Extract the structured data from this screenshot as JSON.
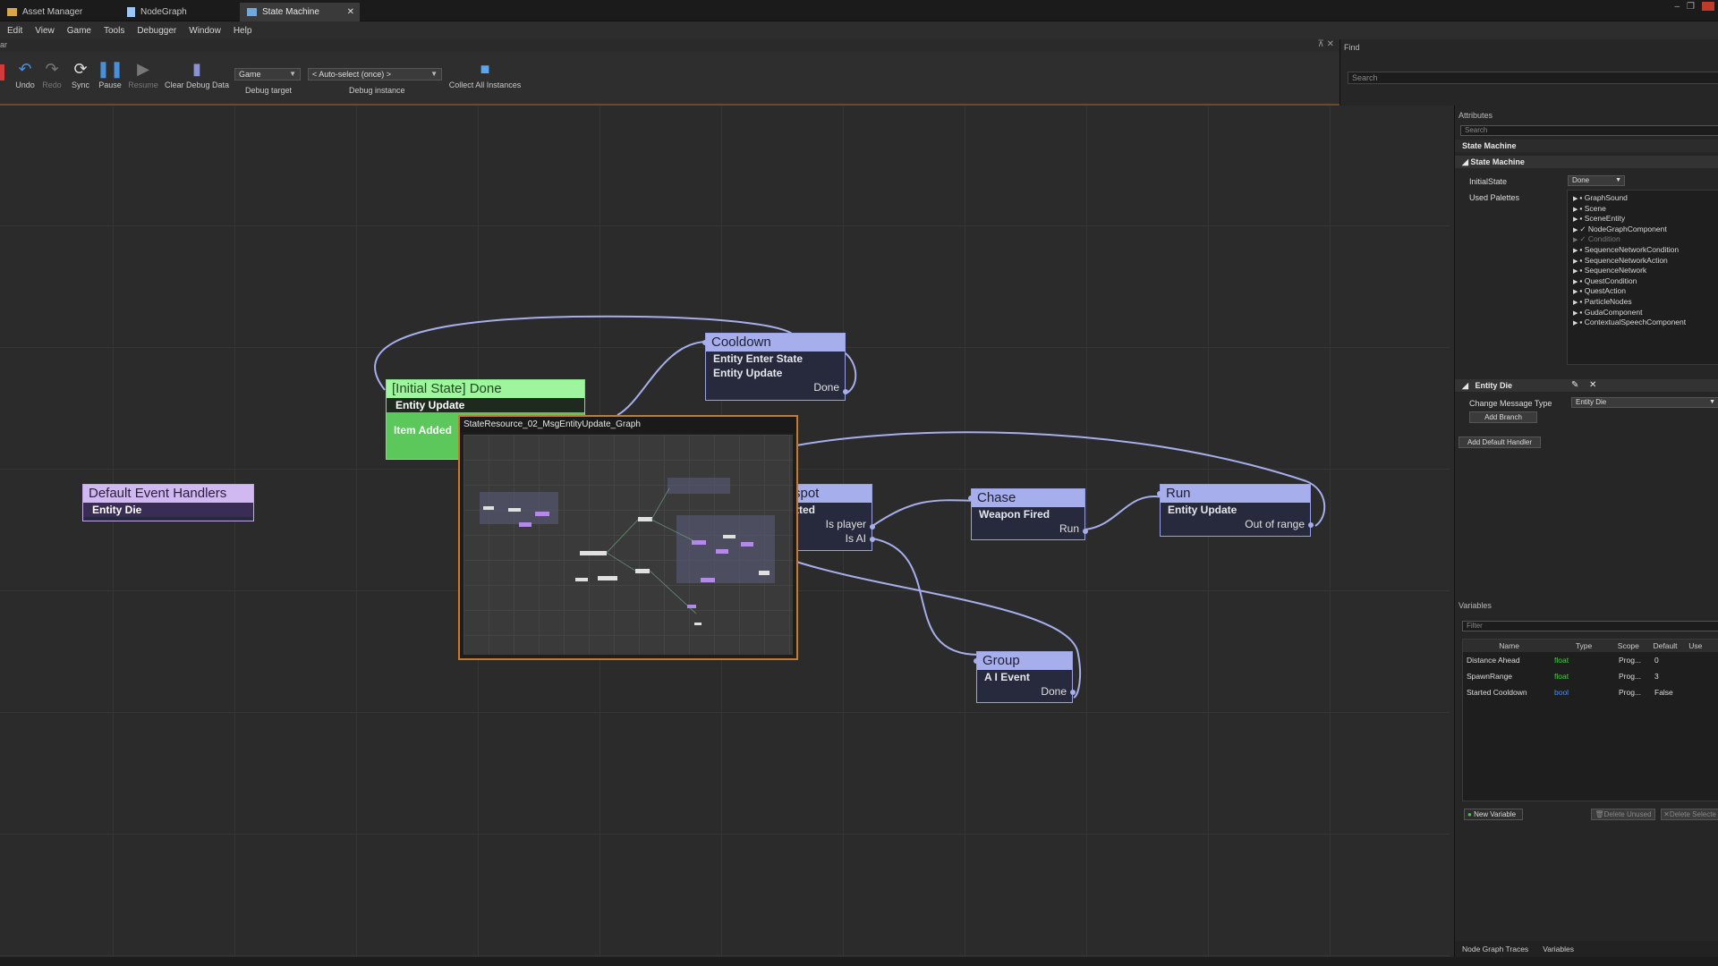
{
  "tabs": [
    {
      "label": "Asset Manager",
      "icon": "folder-icon",
      "color": "#d8a74a"
    },
    {
      "label": "NodeGraph",
      "icon": "document-icon",
      "color": "#9ec6f5"
    },
    {
      "label": "State Machine",
      "icon": "state-machine-icon",
      "color": "#6fa8dc",
      "close": "✕"
    }
  ],
  "menu": [
    "Edit",
    "View",
    "Game",
    "Tools",
    "Debugger",
    "Window",
    "Help"
  ],
  "panel": {
    "title": "ar",
    "pins": "⊼ ✕"
  },
  "toolbar": {
    "undo": "Undo",
    "redo": "Redo",
    "sync": "Sync",
    "pause": "Pause",
    "resume": "Resume",
    "clear_debug": "Clear Debug Data",
    "collect": "Collect All Instances",
    "debug_target_value": "Game",
    "debug_target_label": "Debug target",
    "debug_instance_value": "< Auto-select (once) >",
    "debug_instance_label": "Debug instance"
  },
  "find": {
    "title": "Find",
    "search_placeholder": "Search"
  },
  "nodes": {
    "initial": {
      "title": "[Initial State] Done",
      "row1": "Entity Update",
      "row2": "Item Added"
    },
    "cooldown": {
      "title": "Cooldown",
      "row1": "Entity Enter State",
      "row2": "Entity Update",
      "out": "Done"
    },
    "default": {
      "title": "Default Event Handlers",
      "row1": "Entity Die"
    },
    "spot": {
      "title": "spot",
      "row1": "tted",
      "out1": "Is player",
      "out2": "Is AI"
    },
    "chase": {
      "title": "Chase",
      "row1": "Weapon Fired",
      "out": "Run"
    },
    "run": {
      "title": "Run",
      "row1": "Entity Update",
      "out": "Out of range"
    },
    "group": {
      "title": "Group",
      "row1": "A I Event",
      "out": "Done"
    }
  },
  "popup": {
    "title": "StateResource_02_MsgEntityUpdate_Graph"
  },
  "attributes": {
    "panel_title": "Attributes",
    "search_placeholder": "Search",
    "header": "State Machine",
    "section": "State Machine",
    "initial_state_label": "InitialState",
    "initial_state_value": "Done",
    "used_palettes_label": "Used Palettes",
    "palettes": [
      {
        "name": "GraphSound",
        "checked": false
      },
      {
        "name": "Scene",
        "checked": false
      },
      {
        "name": "SceneEntity",
        "checked": false
      },
      {
        "name": "NodeGraphComponent",
        "checked": true
      },
      {
        "name": "Condition",
        "checked": true,
        "dim": true
      },
      {
        "name": "SequenceNetworkCondition",
        "checked": false
      },
      {
        "name": "SequenceNetworkAction",
        "checked": false
      },
      {
        "name": "SequenceNetwork",
        "checked": false
      },
      {
        "name": "QuestCondition",
        "checked": false
      },
      {
        "name": "QuestAction",
        "checked": false
      },
      {
        "name": "ParticleNodes",
        "checked": false
      },
      {
        "name": "GudaComponent",
        "checked": false
      },
      {
        "name": "ContextualSpeechComponent",
        "checked": false
      }
    ],
    "handler_section": "Entity Die",
    "change_msg_label": "Change Message Type",
    "change_msg_value": "Entity Die",
    "add_branch": "Add Branch",
    "add_default_handler": "Add Default Handler"
  },
  "variables": {
    "panel_title": "Variables",
    "filter_placeholder": "Filter",
    "columns": [
      "Name",
      "Type",
      "Scope",
      "Default",
      "Use"
    ],
    "rows": [
      {
        "name": "Distance Ahead",
        "type": "float",
        "scope": "Prog...",
        "default": "0"
      },
      {
        "name": "SpawnRange",
        "type": "float",
        "scope": "Prog...",
        "default": "3"
      },
      {
        "name": "Started Cooldown",
        "type": "bool",
        "scope": "Prog...",
        "default": "False"
      }
    ],
    "type_colors": {
      "float": "#3fd23f",
      "bool": "#4a8df0"
    },
    "new_variable": "New Variable",
    "delete_unused": "Delete Unused",
    "delete_selected": "Delete Selecte"
  },
  "bottom_tabs": [
    "Node Graph Traces",
    "Variables"
  ]
}
